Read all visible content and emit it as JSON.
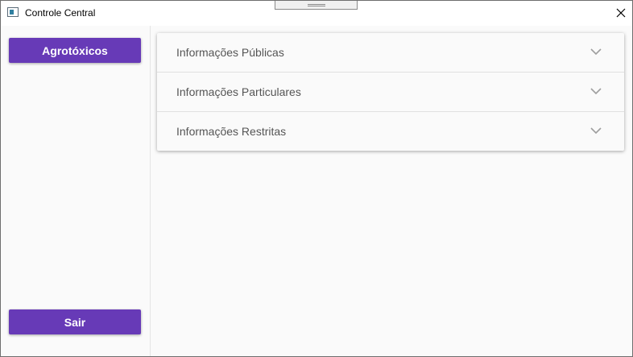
{
  "window": {
    "title": "Controle Central",
    "app_icon": "window-app-icon",
    "close_icon": "close-icon"
  },
  "sidebar": {
    "top_button_label": "Agrotóxicos",
    "bottom_button_label": "Sair"
  },
  "panels": [
    {
      "label": "Informações Públicas",
      "expanded": false,
      "icon": "chevron-down-icon"
    },
    {
      "label": "Informações Particulares",
      "expanded": false,
      "icon": "chevron-down-icon"
    },
    {
      "label": "Informações Restritas",
      "expanded": false,
      "icon": "chevron-down-icon"
    }
  ],
  "colors": {
    "accent": "#673ab7",
    "background": "#fafafa",
    "panel_text": "#555555",
    "chevron": "#9e9e9e"
  }
}
